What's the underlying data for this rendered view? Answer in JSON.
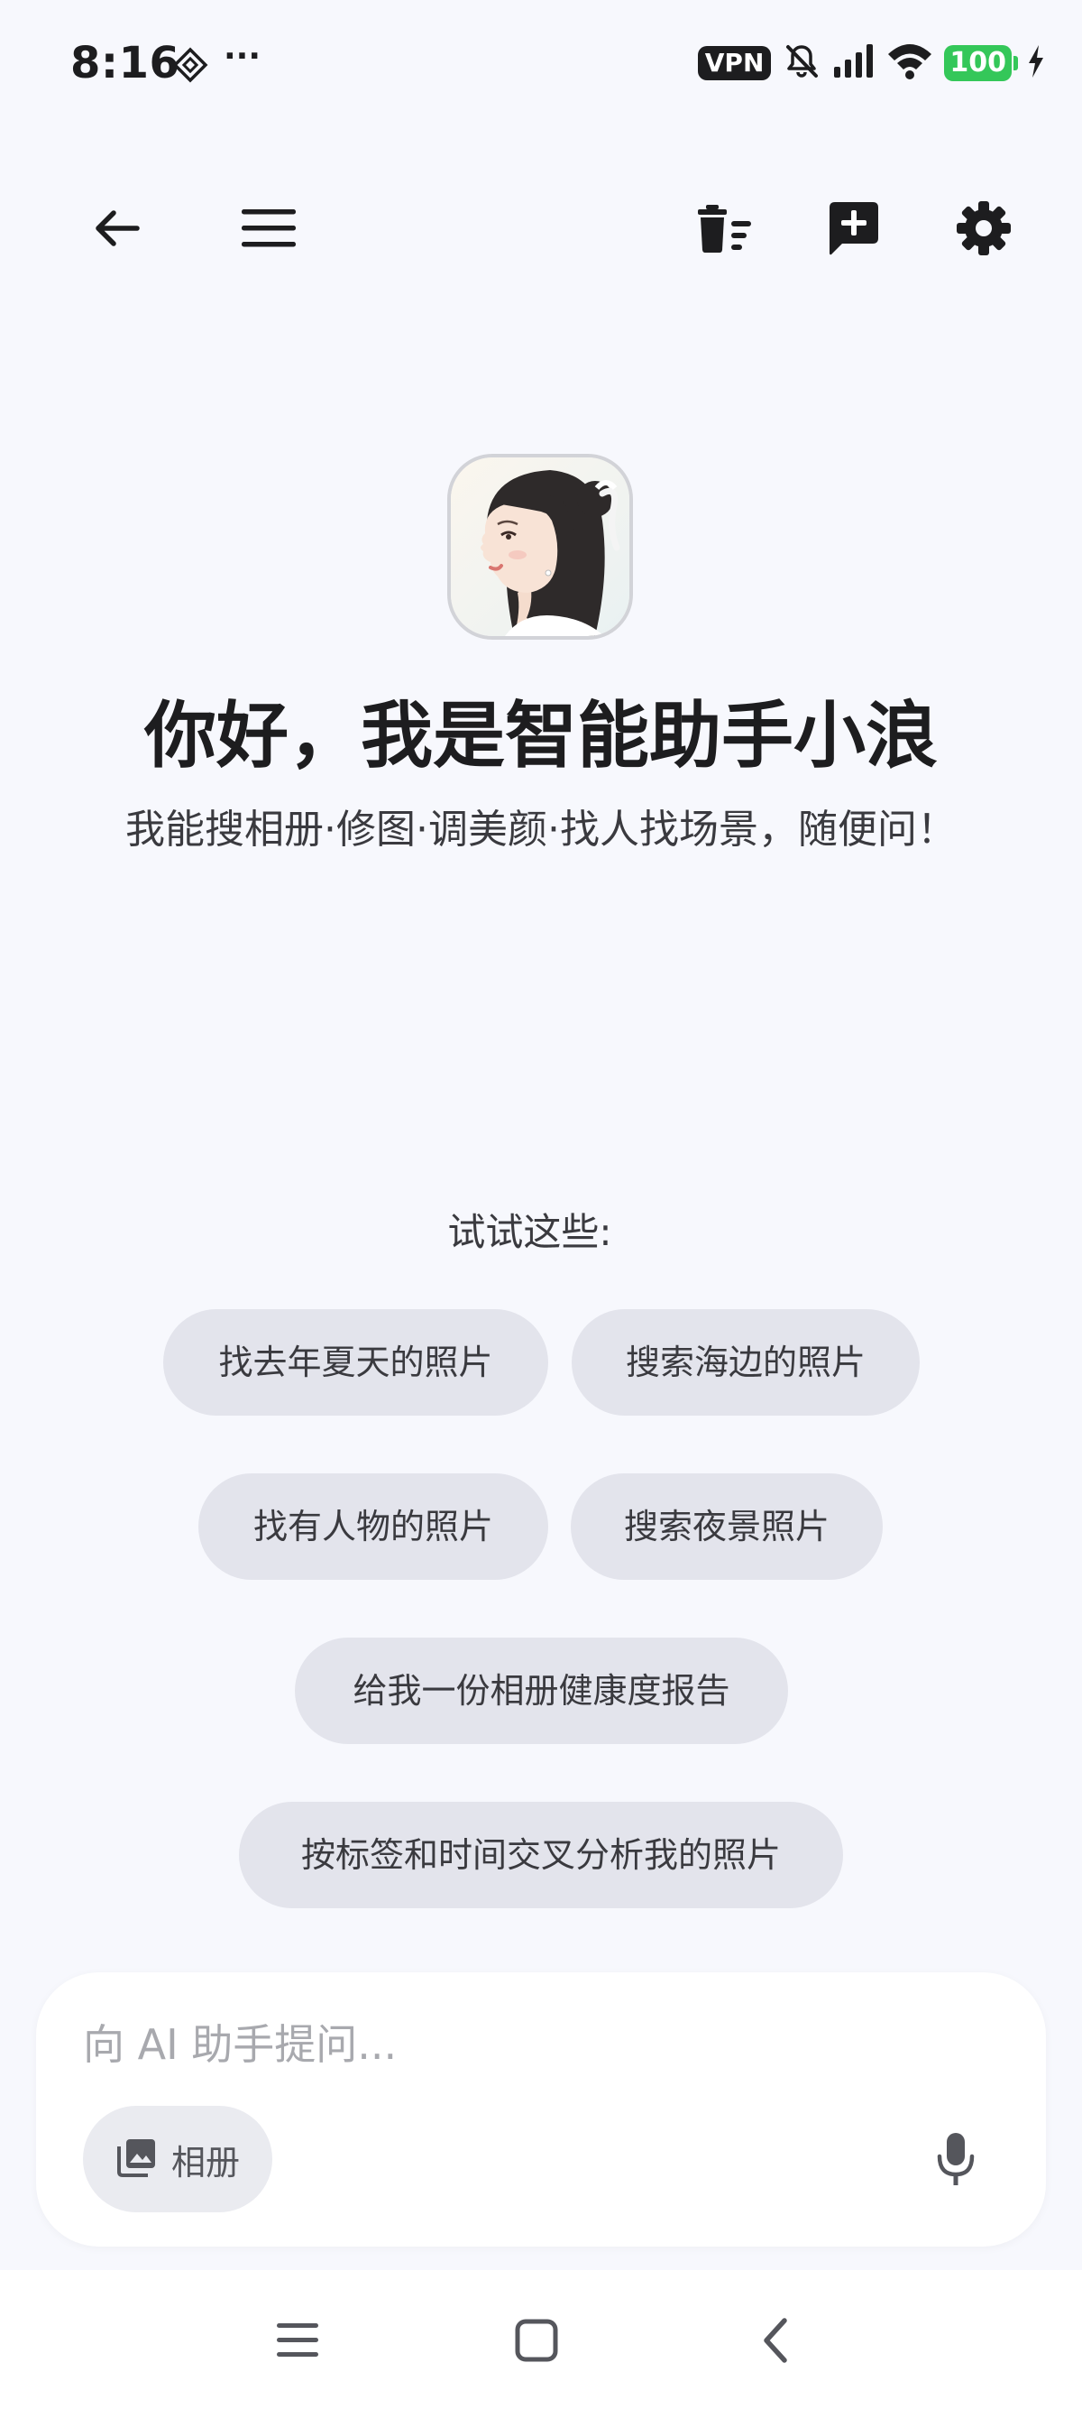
{
  "status_bar": {
    "time": "8:16",
    "more_indicator": "···",
    "vpn_label": "VPN",
    "battery_level": "100",
    "icons": [
      "app-notification-icon",
      "bell-off-icon",
      "signal-icon",
      "wifi-icon",
      "battery-icon",
      "charging-icon"
    ]
  },
  "toolbar": {
    "icons": [
      "back-arrow-icon",
      "menu-icon",
      "clear-history-icon",
      "new-chat-icon",
      "settings-icon"
    ]
  },
  "hero": {
    "title": "你好，我是智能助手小浪",
    "subtitle": "我能搜相册·修图·调美颜·找人找场景，随便问！"
  },
  "suggestions": {
    "label": "试试这些:",
    "chips": [
      "找去年夏天的照片",
      "搜索海边的照片",
      "找有人物的照片",
      "搜索夜景照片",
      "给我一份相册健康度报告",
      "按标签和时间交叉分析我的照片"
    ]
  },
  "composer": {
    "placeholder": "向 AI 助手提问...",
    "value": "",
    "album_label": "相册",
    "icons": [
      "photo-album-icon",
      "microphone-icon"
    ]
  },
  "nav_bar": {
    "icons": [
      "recent-apps-icon",
      "home-icon",
      "back-icon"
    ]
  },
  "colors": {
    "background": "#f7f8fd",
    "chip_background": "#e3e4ec",
    "text_primary": "#1d1d1f",
    "text_secondary": "#3a3a3f",
    "placeholder": "#a8a9ae",
    "battery_green": "#34c759"
  }
}
